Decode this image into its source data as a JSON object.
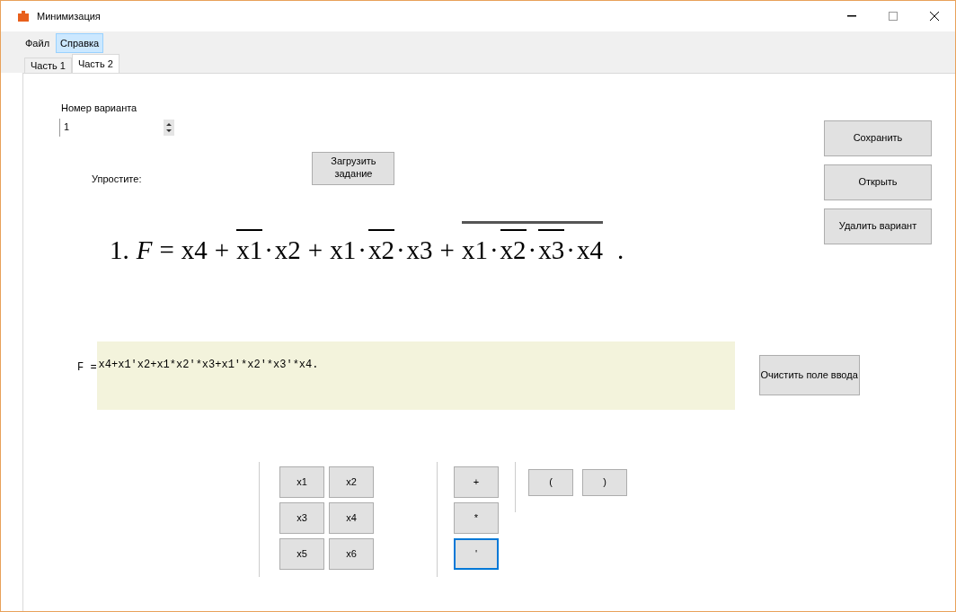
{
  "window": {
    "title": "Минимизация"
  },
  "menu": [
    {
      "label": "Файл",
      "selected": false
    },
    {
      "label": "Справка",
      "selected": true
    }
  ],
  "tabs": [
    {
      "label": "Часть 1",
      "selected": false
    },
    {
      "label": "Часть 2",
      "selected": true
    }
  ],
  "variant": {
    "label": "Номер варианта",
    "value": "1"
  },
  "load_button": "Загрузить задание",
  "task_label": "Упростите:",
  "formula": {
    "number": "1.",
    "lhs": "F",
    "eq": "=",
    "end": ".",
    "plus": "+",
    "dot": "·",
    "terms": [
      {
        "factors": [
          {
            "text": "x4",
            "negated": false
          }
        ]
      },
      {
        "factors": [
          {
            "text": "x1",
            "negated": true
          },
          {
            "text": "x2",
            "negated": false
          }
        ]
      },
      {
        "factors": [
          {
            "text": "x1",
            "negated": false
          },
          {
            "text": "x2",
            "negated": true
          },
          {
            "text": "x3",
            "negated": false
          }
        ]
      },
      {
        "negated": true,
        "factors": [
          {
            "text": "x1",
            "negated": false
          },
          {
            "text": "x2",
            "negated": true
          },
          {
            "text": "x3",
            "negated": true
          },
          {
            "text": "x4",
            "negated": false
          }
        ]
      }
    ]
  },
  "side_buttons": [
    "Сохранить",
    "Открыть",
    "Удалить вариант"
  ],
  "answer": {
    "label": "F =",
    "value": "x4+x1'x2+x1*x2'*x3+x1'*x2'*x3'*x4."
  },
  "clear_button": "Очистить поле ввода",
  "variable_keys": [
    "x1",
    "x2",
    "x3",
    "x4",
    "x5",
    "x6"
  ],
  "operator_keys": [
    {
      "label": "+",
      "focused": false
    },
    {
      "label": "*",
      "focused": false
    },
    {
      "label": "'",
      "focused": true
    }
  ],
  "bracket_keys": [
    "(",
    ")"
  ]
}
